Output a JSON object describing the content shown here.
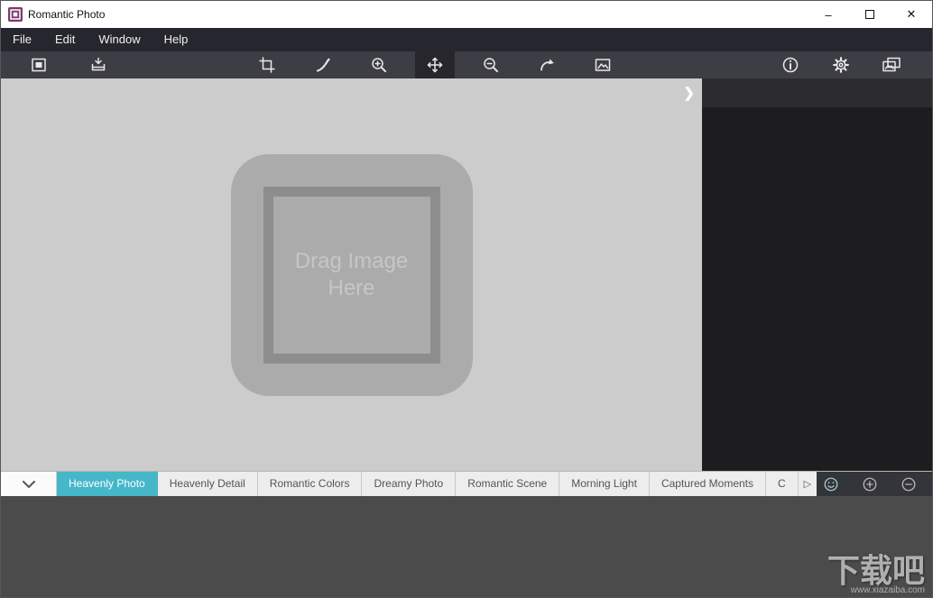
{
  "titlebar": {
    "title": "Romantic Photo",
    "minimize_glyph": "–",
    "close_glyph": "✕"
  },
  "menubar": {
    "items": [
      {
        "label": "File"
      },
      {
        "label": "Edit"
      },
      {
        "label": "Window"
      },
      {
        "label": "Help"
      }
    ]
  },
  "toolbar": {
    "icons": [
      "export-image",
      "import-image",
      "crop",
      "brush",
      "zoom-in",
      "move",
      "zoom-out",
      "redo",
      "image-preview",
      "info",
      "settings",
      "photo-effects"
    ],
    "selected_tool": "move"
  },
  "canvas": {
    "drop_text": "Drag Image Here",
    "panel_collapse_glyph": "❯"
  },
  "tab_strip": {
    "tabs": [
      {
        "label": "Heavenly Photo",
        "selected": true
      },
      {
        "label": "Heavenly Detail"
      },
      {
        "label": "Romantic Colors"
      },
      {
        "label": "Dreamy Photo"
      },
      {
        "label": "Romantic Scene"
      },
      {
        "label": "Morning Light"
      },
      {
        "label": "Captured Moments"
      },
      {
        "label": "C"
      }
    ],
    "scroll_glyph": "▷",
    "side_icons": [
      "smiley",
      "add",
      "remove"
    ]
  },
  "watermark": {
    "brand": "下载吧",
    "site": "www.xiazaiba.com"
  },
  "colors": {
    "accent_teal": "#45b7c8",
    "app_icon_purple": "#7d3a68",
    "toolbar_bg": "#3d3d45",
    "menubar_bg": "#26262e"
  }
}
